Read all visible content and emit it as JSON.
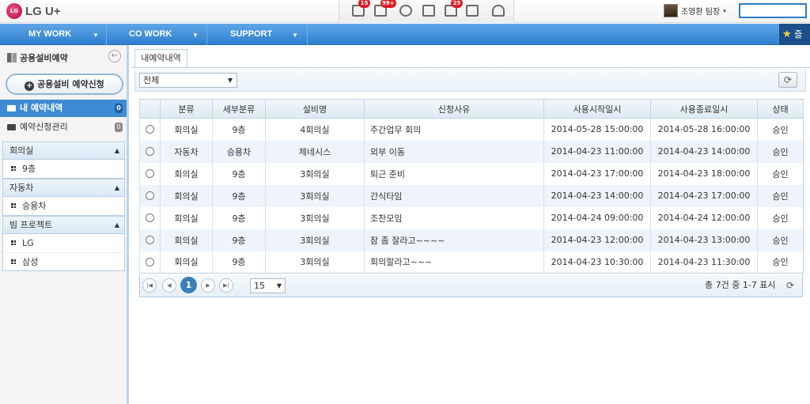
{
  "brand": {
    "logo_mark": "LG",
    "name": "LG U+"
  },
  "toolbar_icons": [
    {
      "name": "mail-icon",
      "badge": "15"
    },
    {
      "name": "chat-icon",
      "badge": "99+"
    },
    {
      "name": "message-icon",
      "badge": ""
    },
    {
      "name": "memo-icon",
      "badge": ""
    },
    {
      "name": "calendar-icon",
      "badge": "25"
    },
    {
      "name": "notebook-icon",
      "badge": ""
    },
    {
      "name": "person-add-icon",
      "badge": ""
    }
  ],
  "user": {
    "name": "조영환 팀장"
  },
  "menu": [
    {
      "label": "MY WORK"
    },
    {
      "label": "CO WORK"
    },
    {
      "label": "SUPPORT"
    }
  ],
  "favorite": {
    "label": "즐겨"
  },
  "sidebar": {
    "title": "공용설비예약",
    "primary_button": "공용설비 예약신청",
    "nav": [
      {
        "label": "내 예약내역",
        "count": "0"
      },
      {
        "label": "예약신청관리",
        "count": "0"
      }
    ],
    "groups": [
      {
        "title": "회의실",
        "items": [
          "9층"
        ]
      },
      {
        "title": "자동차",
        "items": [
          "승용차"
        ]
      },
      {
        "title": "빔 프로젝트",
        "items": [
          "LG",
          "삼성"
        ]
      }
    ]
  },
  "main": {
    "tab": "내예약내역",
    "filter": {
      "selected": "전체"
    },
    "table": {
      "columns": [
        "분류",
        "세부분류",
        "설비명",
        "신청사유",
        "사용시작일시",
        "사용종료일시",
        "상태"
      ],
      "rows": [
        [
          "회의실",
          "9층",
          "4회의실",
          "주간업무 회의",
          "2014-05-28 15:00:00",
          "2014-05-28 16:00:00",
          "승인"
        ],
        [
          "자동차",
          "승용차",
          "제네시스",
          "외부 이동",
          "2014-04-23 11:00:00",
          "2014-04-23 14:00:00",
          "승인"
        ],
        [
          "회의실",
          "9층",
          "3회의실",
          "퇴근 준비",
          "2014-04-23 17:00:00",
          "2014-04-23 18:00:00",
          "승인"
        ],
        [
          "회의실",
          "9층",
          "3회의실",
          "간식타임",
          "2014-04-23 14:00:00",
          "2014-04-23 17:00:00",
          "승인"
        ],
        [
          "회의실",
          "9층",
          "3회의실",
          "조찬모임",
          "2014-04-24 09:00:00",
          "2014-04-24 12:00:00",
          "승인"
        ],
        [
          "회의실",
          "9층",
          "3회의실",
          "잠 좀 잘라고~~~~",
          "2014-04-23 12:00:00",
          "2014-04-23 13:00:00",
          "승인"
        ],
        [
          "회의실",
          "9층",
          "3회의실",
          "회의할라고~~~",
          "2014-04-23 10:30:00",
          "2014-04-23 11:30:00",
          "승인"
        ]
      ]
    },
    "pager": {
      "current_page": "1",
      "page_size": "15",
      "summary": "총 7건 중 1-7 표시"
    }
  }
}
